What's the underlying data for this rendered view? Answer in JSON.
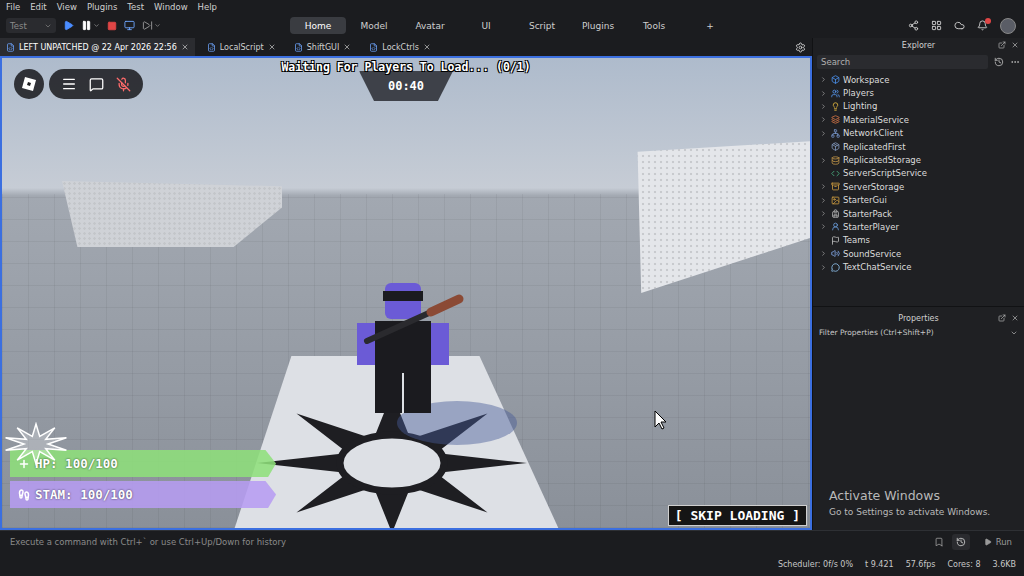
{
  "menu": [
    "File",
    "Edit",
    "View",
    "Plugins",
    "Test",
    "Window",
    "Help"
  ],
  "toolbar": {
    "mode": "Test",
    "ribbonTabs": [
      {
        "label": "Home",
        "selected": true
      },
      {
        "label": "Model",
        "selected": false
      },
      {
        "label": "Avatar",
        "selected": false
      },
      {
        "label": "UI",
        "selected": false
      },
      {
        "label": "Script",
        "selected": false
      },
      {
        "label": "Plugins",
        "selected": false
      },
      {
        "label": "Tools",
        "selected": false
      },
      {
        "label": "+",
        "selected": false
      }
    ]
  },
  "docTabs": [
    {
      "label": "LEFT UNPATCHED @ 22 Apr 2026 22:56",
      "selected": true
    },
    {
      "label": "LocalScript",
      "selected": false
    },
    {
      "label": "ShiftGUI",
      "selected": false
    },
    {
      "label": "LockCtrls",
      "selected": false
    }
  ],
  "game": {
    "status": "Waiting For Players To Load... (0/1)",
    "timer": "00:40",
    "stats": [
      {
        "label": "HP: 100/100",
        "level": 1,
        "color": "#8ee07a"
      },
      {
        "label": "STAM: 100/100",
        "level": 1,
        "color": "#b79cf2"
      }
    ],
    "skip": "[ SKIP LOADING ]"
  },
  "explorer": {
    "title": "Explorer",
    "search": {
      "placeholder": "Search"
    },
    "items": [
      {
        "label": "Workspace",
        "expandable": true
      },
      {
        "label": "Players",
        "expandable": true
      },
      {
        "label": "Lighting",
        "expandable": true
      },
      {
        "label": "MaterialService",
        "expandable": true
      },
      {
        "label": "NetworkClient",
        "expandable": true
      },
      {
        "label": "ReplicatedFirst",
        "expandable": false
      },
      {
        "label": "ReplicatedStorage",
        "expandable": true
      },
      {
        "label": "ServerScriptService",
        "expandable": false
      },
      {
        "label": "ServerStorage",
        "expandable": true
      },
      {
        "label": "StarterGui",
        "expandable": true
      },
      {
        "label": "StarterPack",
        "expandable": true
      },
      {
        "label": "StarterPlayer",
        "expandable": true
      },
      {
        "label": "Teams",
        "expandable": false
      },
      {
        "label": "SoundService",
        "expandable": true
      },
      {
        "label": "TextChatService",
        "expandable": true
      }
    ]
  },
  "properties": {
    "title": "Properties",
    "filter": {
      "placeholder": "Filter Properties (Ctrl+Shift+P)"
    }
  },
  "watermark": {
    "title": "Activate Windows",
    "subtitle": "Go to Settings to activate Windows."
  },
  "commandBar": {
    "placeholder": "Execute a command with Ctrl+` or use Ctrl+Up/Down for history",
    "run": "Run"
  },
  "statusBar": [
    "Scheduler: 0f/s 0%",
    "t 9.421",
    "57.6fps",
    "Cores: 8",
    "3.6KB"
  ]
}
